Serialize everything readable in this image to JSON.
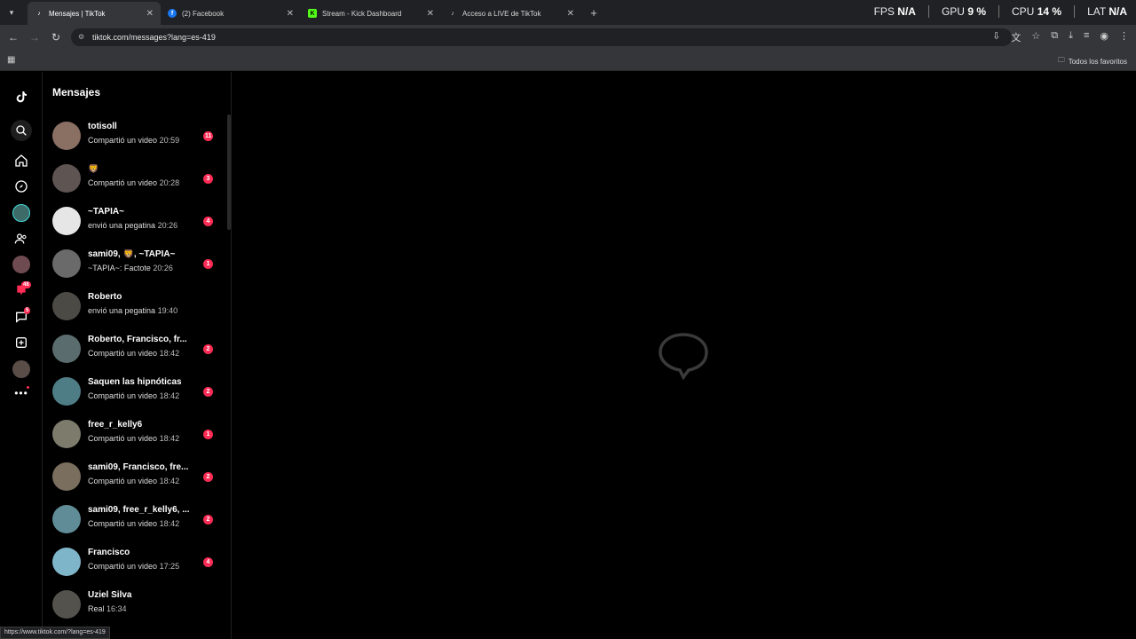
{
  "browser": {
    "tabs": [
      {
        "title": "Mensajes | TikTok",
        "active": true,
        "icon": "tiktok-icon"
      },
      {
        "title": "(2) Facebook",
        "active": false,
        "icon": "facebook-icon"
      },
      {
        "title": "Stream - Kick Dashboard",
        "active": false,
        "icon": "kick-icon"
      },
      {
        "title": "Acceso a LIVE de TikTok",
        "active": false,
        "icon": "tiktok-icon"
      }
    ],
    "url": "tiktok.com/messages?lang=es-419",
    "bookmarks_folder": "Todos los favoritos",
    "status_url": "https://www.tiktok.com/?lang=es-419"
  },
  "perf": {
    "fps_label": "FPS",
    "fps_value": "N/A",
    "gpu_label": "GPU",
    "gpu_value": "9",
    "cpu_label": "CPU",
    "cpu_value": "14",
    "lat_label": "LAT",
    "lat_value": "N/A",
    "percent": "%"
  },
  "rail": {
    "activity_badge": "48",
    "messages_badge": "5"
  },
  "messages": {
    "title": "Mensajes",
    "conversations": [
      {
        "name": "totisoll",
        "preview": "Compartió un video",
        "time": "20:59",
        "count": "11",
        "avatar_color": "#8a6f63"
      },
      {
        "name": "🦁",
        "preview": "Compartió un video",
        "time": "20:28",
        "count": "3",
        "avatar_color": "#5e5552"
      },
      {
        "name": "~TAPIA~",
        "preview": "envió una pegatina",
        "time": "20:26",
        "count": "4",
        "avatar_color": "#e6e6e6"
      },
      {
        "name": "sami09, 🦁, ~TAPIA~",
        "preview": "~TAPIA~: Factote",
        "time": "20:26",
        "count": "1",
        "avatar_color": "#6a6a6a"
      },
      {
        "name": "Roberto",
        "preview": "envió una pegatina",
        "time": "19:40",
        "count": "",
        "avatar_color": "#4c4a45"
      },
      {
        "name": "Roberto, Francisco, fr...",
        "preview": "Compartió un video",
        "time": "18:42",
        "count": "2",
        "avatar_color": "#5b6c6e"
      },
      {
        "name": "Saquen las hipnóticas",
        "preview": "Compartió un video",
        "time": "18:42",
        "count": "2",
        "avatar_color": "#4f7d86"
      },
      {
        "name": "free_r_kelly6",
        "preview": "Compartió un video",
        "time": "18:42",
        "count": "1",
        "avatar_color": "#7d7b6b"
      },
      {
        "name": "sami09, Francisco, fre...",
        "preview": "Compartió un video",
        "time": "18:42",
        "count": "2",
        "avatar_color": "#7a6e5e"
      },
      {
        "name": "sami09, free_r_kelly6, ...",
        "preview": "Compartió un video",
        "time": "18:42",
        "count": "2",
        "avatar_color": "#5f8c96"
      },
      {
        "name": "Francisco",
        "preview": "Compartió un video",
        "time": "17:25",
        "count": "4",
        "avatar_color": "#7fb5c9"
      },
      {
        "name": "Uziel Silva",
        "preview": "Real",
        "time": "16:34",
        "count": "",
        "avatar_color": "#54524c"
      }
    ]
  }
}
